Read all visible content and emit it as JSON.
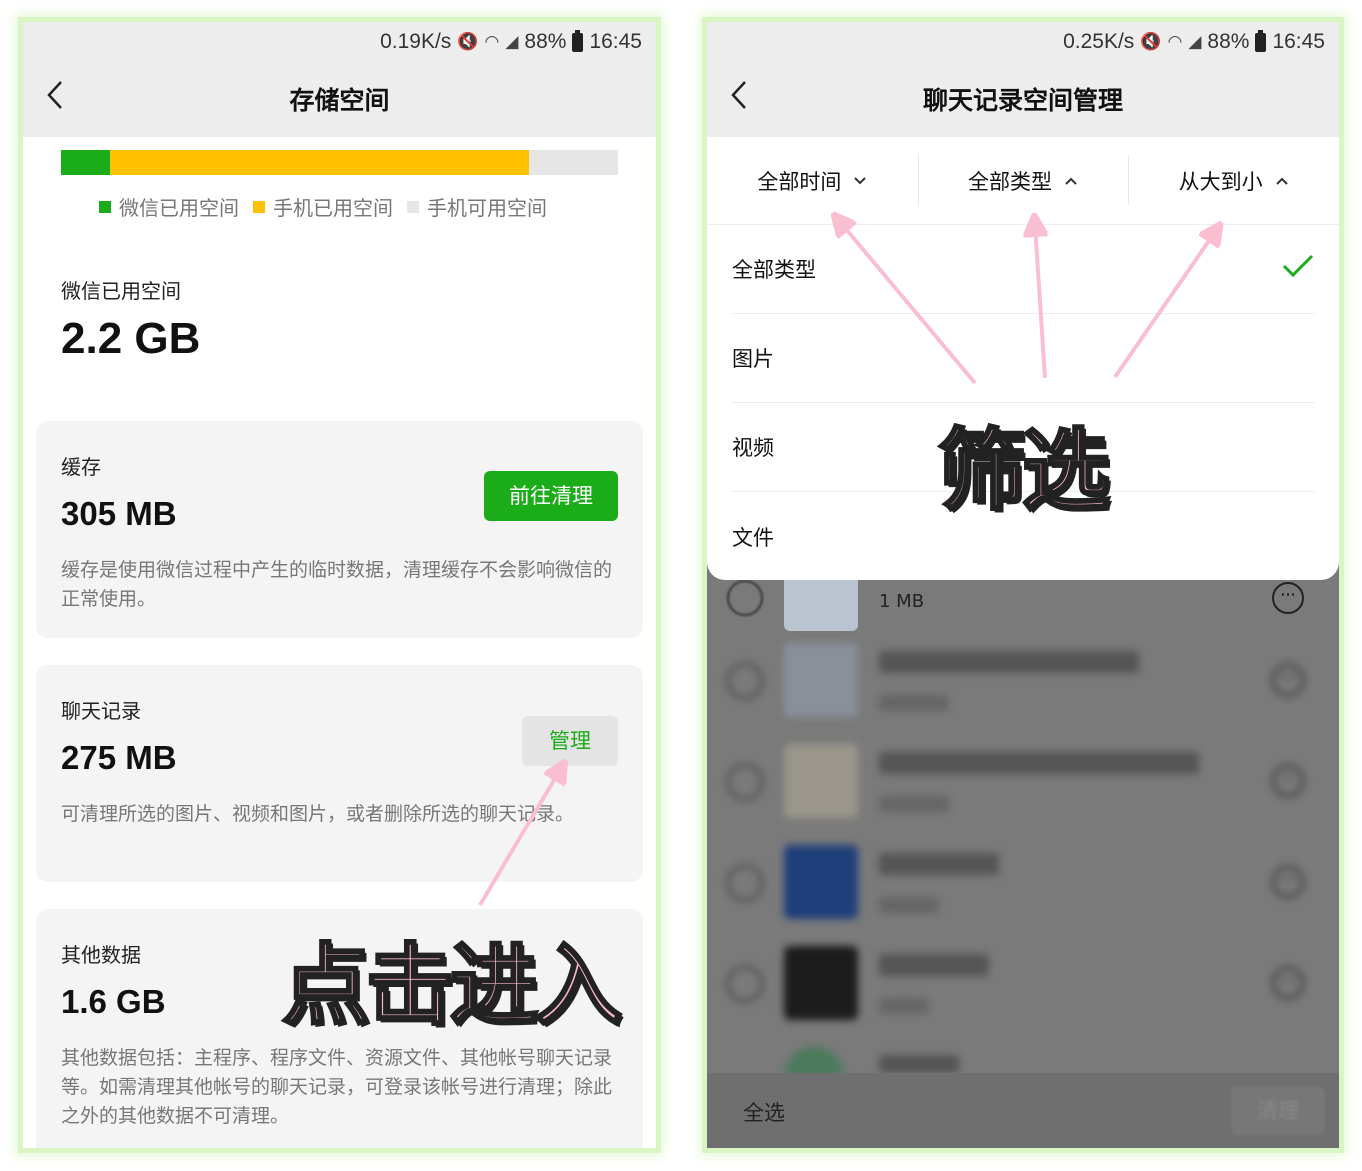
{
  "left": {
    "status": {
      "speed": "0.19K/s",
      "battery": "88%",
      "time": "16:45"
    },
    "title": "存储空间",
    "usage": {
      "wechat_fraction": 0.088,
      "phone_fraction": 0.752,
      "colors": {
        "wechat": "#1aad19",
        "phone": "#fdc100",
        "free": "#e6e6e6"
      }
    },
    "legend": [
      "微信已用空间",
      "手机已用空间",
      "手机可用空间"
    ],
    "wechat_used": {
      "label": "微信已用空间",
      "value": "2.2 GB"
    },
    "cache": {
      "label": "缓存",
      "value": "305 MB",
      "button": "前往清理",
      "desc": "缓存是使用微信过程中产生的临时数据，清理缓存不会影响微信的正常使用。"
    },
    "chat": {
      "label": "聊天记录",
      "value": "275 MB",
      "button": "管理",
      "desc": "可清理所选的图片、视频和图片，或者删除所选的聊天记录。"
    },
    "other": {
      "label": "其他数据",
      "value": "1.6 GB",
      "desc": "其他数据包括：主程序、程序文件、资源文件、其他帐号聊天记录等。如需清理其他帐号的聊天记录，可登录该帐号进行清理；除此之外的其他数据不可清理。"
    },
    "annotation": "点击进入"
  },
  "right": {
    "status": {
      "speed": "0.25K/s",
      "battery": "88%",
      "time": "16:45"
    },
    "title": "聊天记录空间管理",
    "tabs": [
      {
        "label": "全部时间",
        "chevron": "down"
      },
      {
        "label": "全部类型",
        "chevron": "up"
      },
      {
        "label": "从大到小",
        "chevron": "up"
      }
    ],
    "options": [
      "全部类型",
      "图片",
      "视频",
      "文件"
    ],
    "selected_option": "全部类型",
    "first_row_size": "1 MB",
    "select_all": "全选",
    "clear": "清理",
    "annotation": "筛选"
  }
}
